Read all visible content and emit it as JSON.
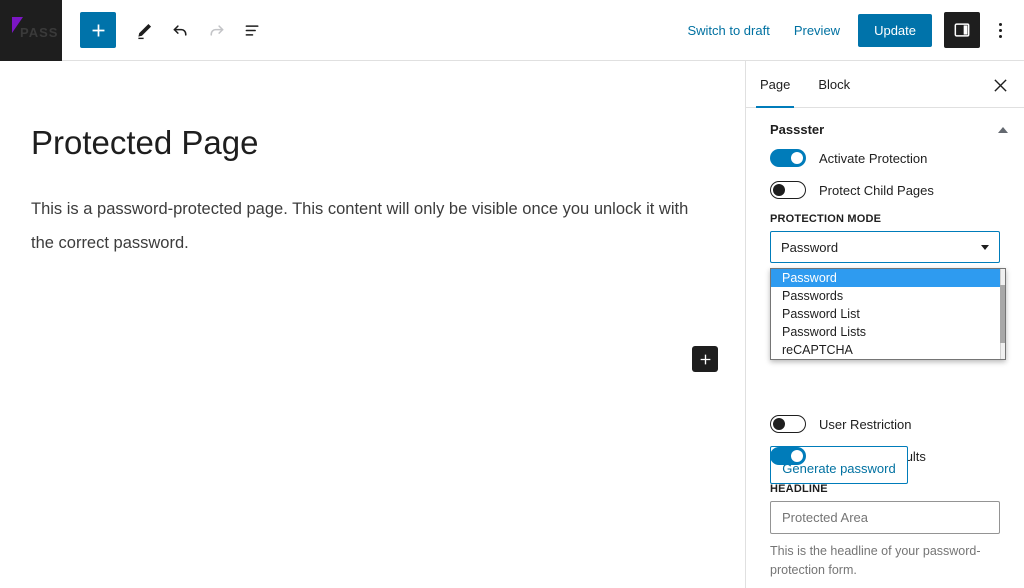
{
  "colors": {
    "accent_blue": "#0073aa",
    "tab_underline": "#007cba",
    "dropdown_highlight": "#2e9bf0",
    "logo_purple": "#7b16c4",
    "dark": "#1e1e1e"
  },
  "topbar": {
    "logo_text": "PASS",
    "add_block_icon": "plus-icon",
    "tools": [
      {
        "name": "edit-tool",
        "icon": "pencil-icon"
      },
      {
        "name": "undo",
        "icon": "undo-arrow-icon"
      },
      {
        "name": "redo",
        "icon": "redo-arrow-icon"
      },
      {
        "name": "list-view",
        "icon": "list-view-icon"
      }
    ],
    "switch_to_draft": "Switch to draft",
    "preview": "Preview",
    "update": "Update",
    "panel_toggle_icon": "sidebar-panel-icon",
    "more_options_icon": "kebab-menu-icon"
  },
  "content": {
    "title": "Protected Page",
    "body": "This is a password-protected page. This content will only be visible once you unlock it with the correct password.",
    "add_block_icon": "plus-icon"
  },
  "sidebar": {
    "tabs": [
      {
        "label": "Page",
        "active": true
      },
      {
        "label": "Block",
        "active": false
      }
    ],
    "close_icon": "close-icon",
    "panel": {
      "title": "Passster",
      "collapse_icon": "chevron-up-icon"
    },
    "toggles": [
      {
        "label": "Activate Protection",
        "state": "on"
      },
      {
        "label": "Protect Child Pages",
        "state": "off"
      }
    ],
    "protection_mode": {
      "label": "PROTECTION MODE",
      "value": "Password",
      "chevron_icon": "chevron-down-icon",
      "options": [
        {
          "label": "Password",
          "selected": true
        },
        {
          "label": "Passwords",
          "selected": false
        },
        {
          "label": "Password List",
          "selected": false
        },
        {
          "label": "Password Lists",
          "selected": false
        },
        {
          "label": "reCAPTCHA",
          "selected": false
        }
      ]
    },
    "generate_password": "Generate password",
    "toggles2": [
      {
        "label": "User Restriction",
        "state": "off"
      },
      {
        "label": "Overwrite Defaults",
        "state": "on"
      }
    ],
    "headline": {
      "label": "HEADLINE",
      "value": "",
      "placeholder": "Protected Area",
      "help": "This is the headline of your password-protection form."
    }
  }
}
